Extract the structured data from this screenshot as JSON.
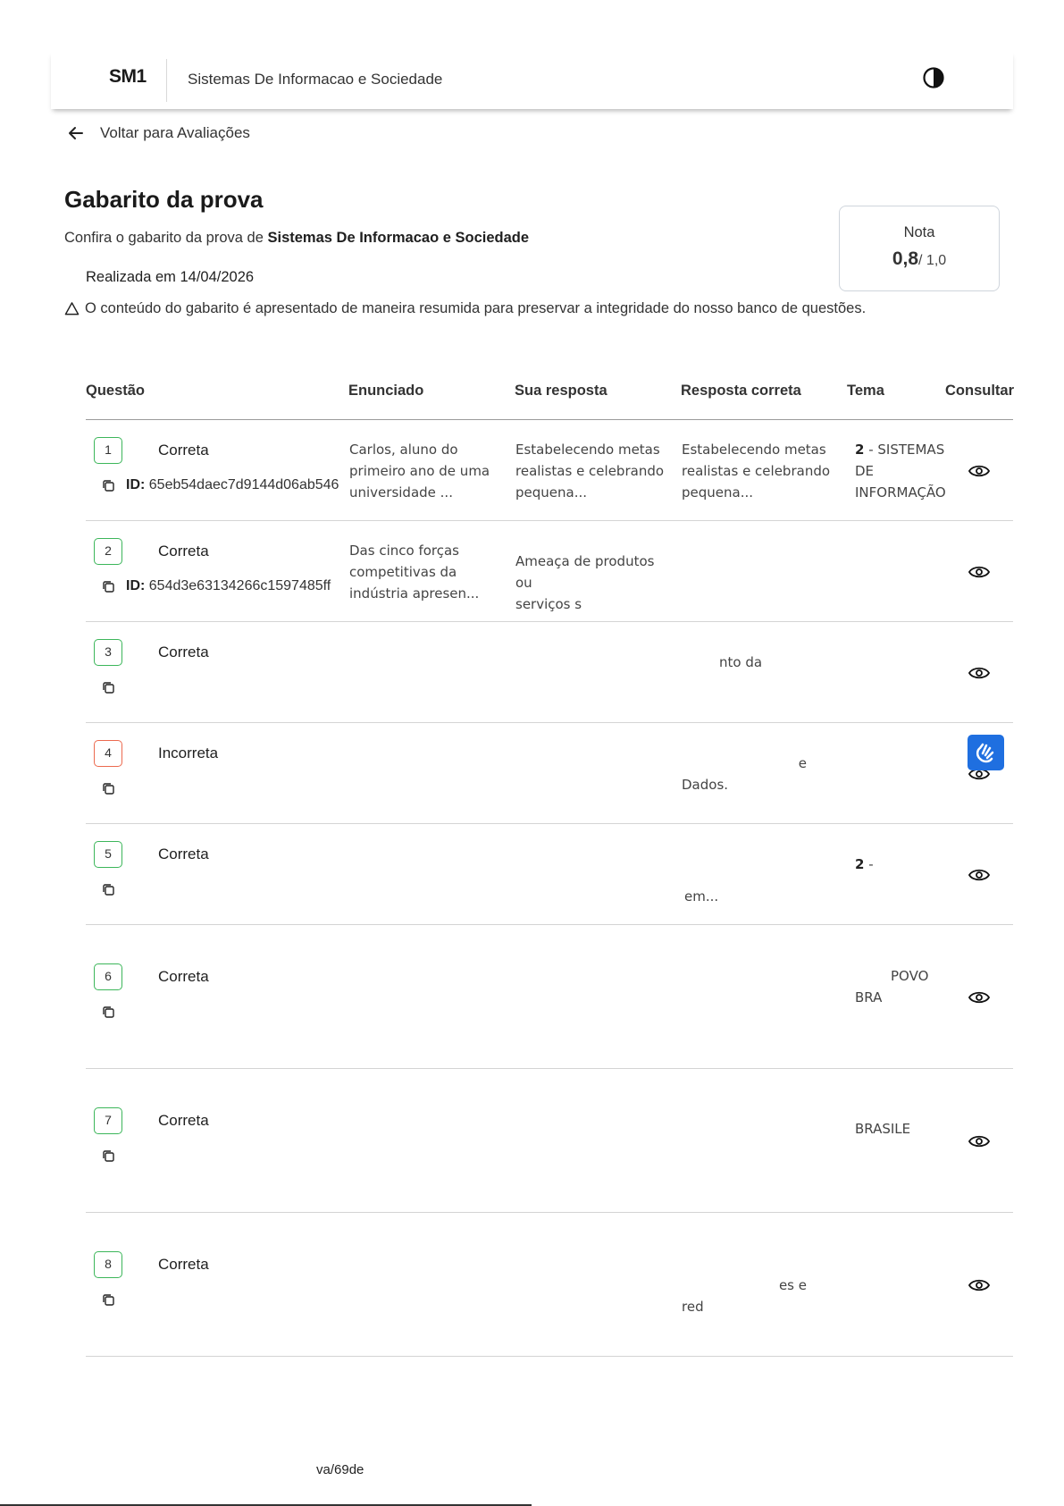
{
  "header": {
    "logo": "SM1",
    "course_title": "Sistemas De Informacao e Sociedade",
    "contrast_icon": "contrast-icon"
  },
  "back_link": {
    "label": "Voltar para Avaliações",
    "icon": "arrow-left-icon"
  },
  "page": {
    "title": "Gabarito da prova",
    "subtitle_prefix": "Confira o gabarito da prova de ",
    "subtitle_course": "Sistemas De Informacao e Sociedade",
    "date_text": "Realizada em 14/04/2026",
    "warning_text": "O conteúdo do gabarito é apresentado de maneira resumida para preservar a integridade do nosso banco de questões."
  },
  "grade": {
    "label": "Nota",
    "value": "0,8",
    "max": "/ 1,0"
  },
  "table": {
    "headers": {
      "questao": "Questão",
      "enunciado": "Enunciado",
      "sua_resposta": "Sua resposta",
      "resposta_correta": "Resposta correta",
      "tema": "Tema",
      "consultar": "Consultar"
    },
    "rows": [
      {
        "num": "1",
        "status": "Correta",
        "ok": true,
        "id_label": "ID:",
        "id_value": "65eb54daec7d9144d06ab546",
        "enunciado": [
          "Carlos, aluno do",
          "primeiro ano de uma",
          "universidade ..."
        ],
        "sua_resposta": [
          "Estabelecendo metas",
          "realistas e celebrando",
          "pequena..."
        ],
        "resposta_correta": [
          "Estabelecendo metas",
          "realistas e celebrando",
          "pequena..."
        ],
        "tema_num": "2",
        "tema": [
          " - SISTEMAS",
          "DE",
          "INFORMAÇÃO"
        ]
      },
      {
        "num": "2",
        "status": "Correta",
        "ok": true,
        "id_label": "ID:",
        "id_value": "654d3e63134266c1597485ff",
        "enunciado": [
          "Das cinco forças",
          "competitivas da",
          "indústria apresen..."
        ],
        "sua_resposta": [
          "Ameaça de produtos ou",
          "serviços s"
        ],
        "resposta_correta": [],
        "tema_num": "",
        "tema": []
      },
      {
        "num": "3",
        "status": "Correta",
        "ok": true,
        "resposta_correta": [
          "nto da"
        ]
      },
      {
        "num": "4",
        "status": "Incorreta",
        "ok": false,
        "resposta_correta": [
          "e",
          "Dados."
        ]
      },
      {
        "num": "5",
        "status": "Correta",
        "ok": true,
        "resposta_correta": [
          "em..."
        ],
        "tema_num": "2",
        "tema": [
          " -"
        ]
      },
      {
        "num": "6",
        "status": "Correta",
        "ok": true,
        "tema": [
          "POVO",
          "BRA"
        ]
      },
      {
        "num": "7",
        "status": "Correta",
        "ok": true,
        "tema": [
          "BRASILE"
        ]
      },
      {
        "num": "8",
        "status": "Correta",
        "ok": true,
        "resposta_correta": [
          "es e",
          "red"
        ]
      }
    ]
  },
  "footer": {
    "fragment": "va/69de"
  },
  "colors": {
    "correct": "#3cb65a",
    "incorrect": "#ec6a4f",
    "vlibras": "#1f6fe0"
  }
}
